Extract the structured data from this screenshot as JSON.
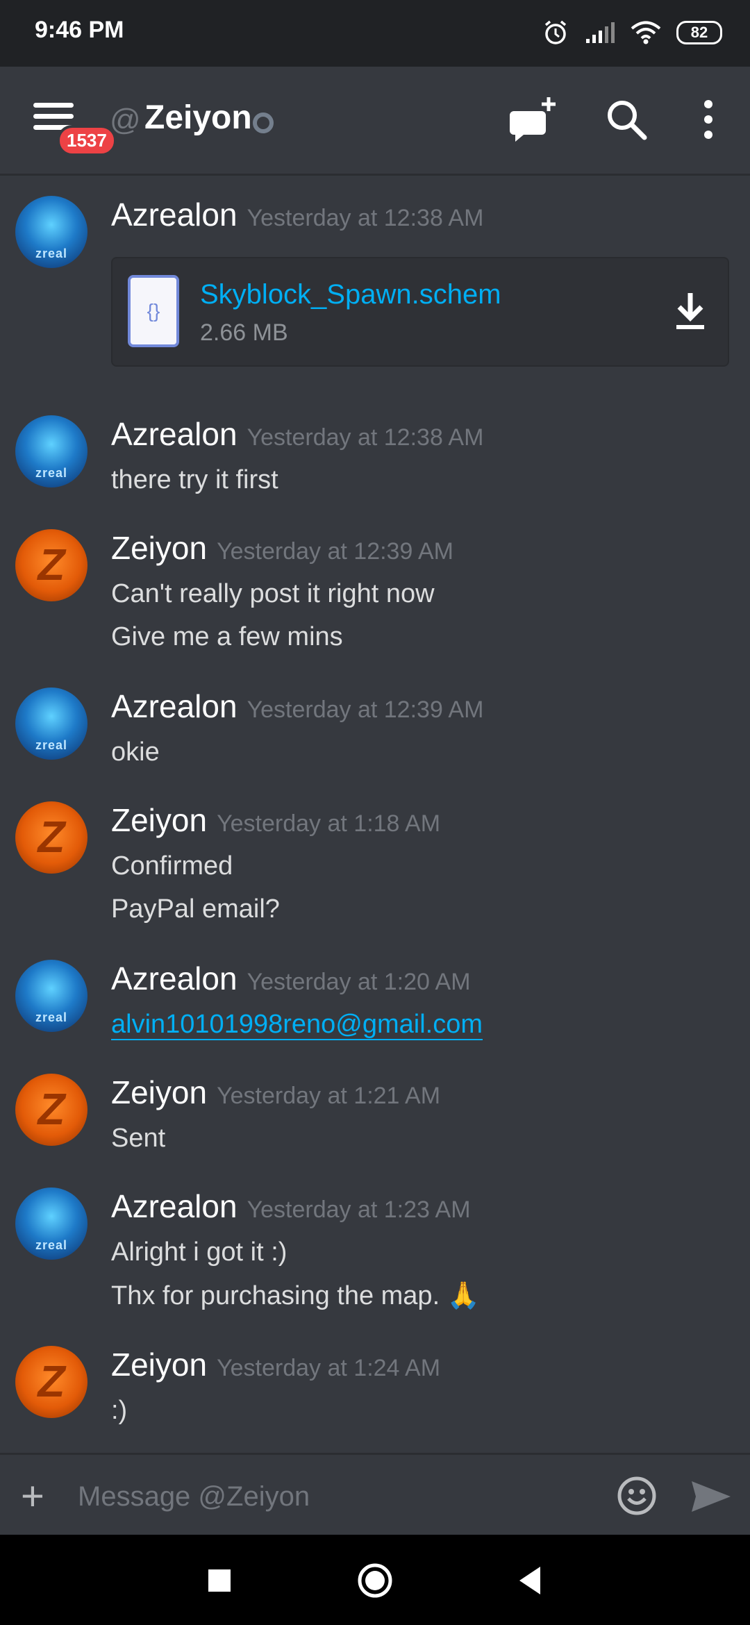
{
  "status_bar": {
    "time": "9:46 PM",
    "battery": "82"
  },
  "header": {
    "unread_badge": "1537",
    "at_symbol": "@",
    "channel_name": "Zeiyon"
  },
  "attachment": {
    "file_name": "Skyblock_Spawn.schem",
    "file_size": "2.66 MB",
    "icon_text": "{}"
  },
  "messages": [
    {
      "author": "Azrealon",
      "timestamp": "Yesterday at 12:38 AM",
      "lines": []
    },
    {
      "author": "Azrealon",
      "timestamp": "Yesterday at 12:38 AM",
      "lines": [
        "there try it first"
      ]
    },
    {
      "author": "Zeiyon",
      "timestamp": "Yesterday at 12:39 AM",
      "lines": [
        "Can't really post it right now",
        "Give me a few mins"
      ]
    },
    {
      "author": "Azrealon",
      "timestamp": "Yesterday at 12:39 AM",
      "lines": [
        "okie"
      ]
    },
    {
      "author": "Zeiyon",
      "timestamp": "Yesterday at 1:18 AM",
      "lines": [
        "Confirmed",
        "PayPal email?"
      ]
    },
    {
      "author": "Azrealon",
      "timestamp": "Yesterday at 1:20 AM",
      "lines": [
        "alvin10101998reno@gmail.com"
      ]
    },
    {
      "author": "Zeiyon",
      "timestamp": "Yesterday at 1:21 AM",
      "lines": [
        "Sent"
      ]
    },
    {
      "author": "Azrealon",
      "timestamp": "Yesterday at 1:23 AM",
      "lines": [
        "Alright i got it :)",
        "Thx for purchasing the map. 🙏"
      ]
    },
    {
      "author": "Zeiyon",
      "timestamp": "Yesterday at 1:24 AM",
      "lines": [
        ":)"
      ]
    }
  ],
  "composer": {
    "placeholder": "Message @Zeiyon"
  },
  "colors": {
    "background": "#36393f",
    "link": "#00aff4",
    "badge": "#ed4245"
  }
}
